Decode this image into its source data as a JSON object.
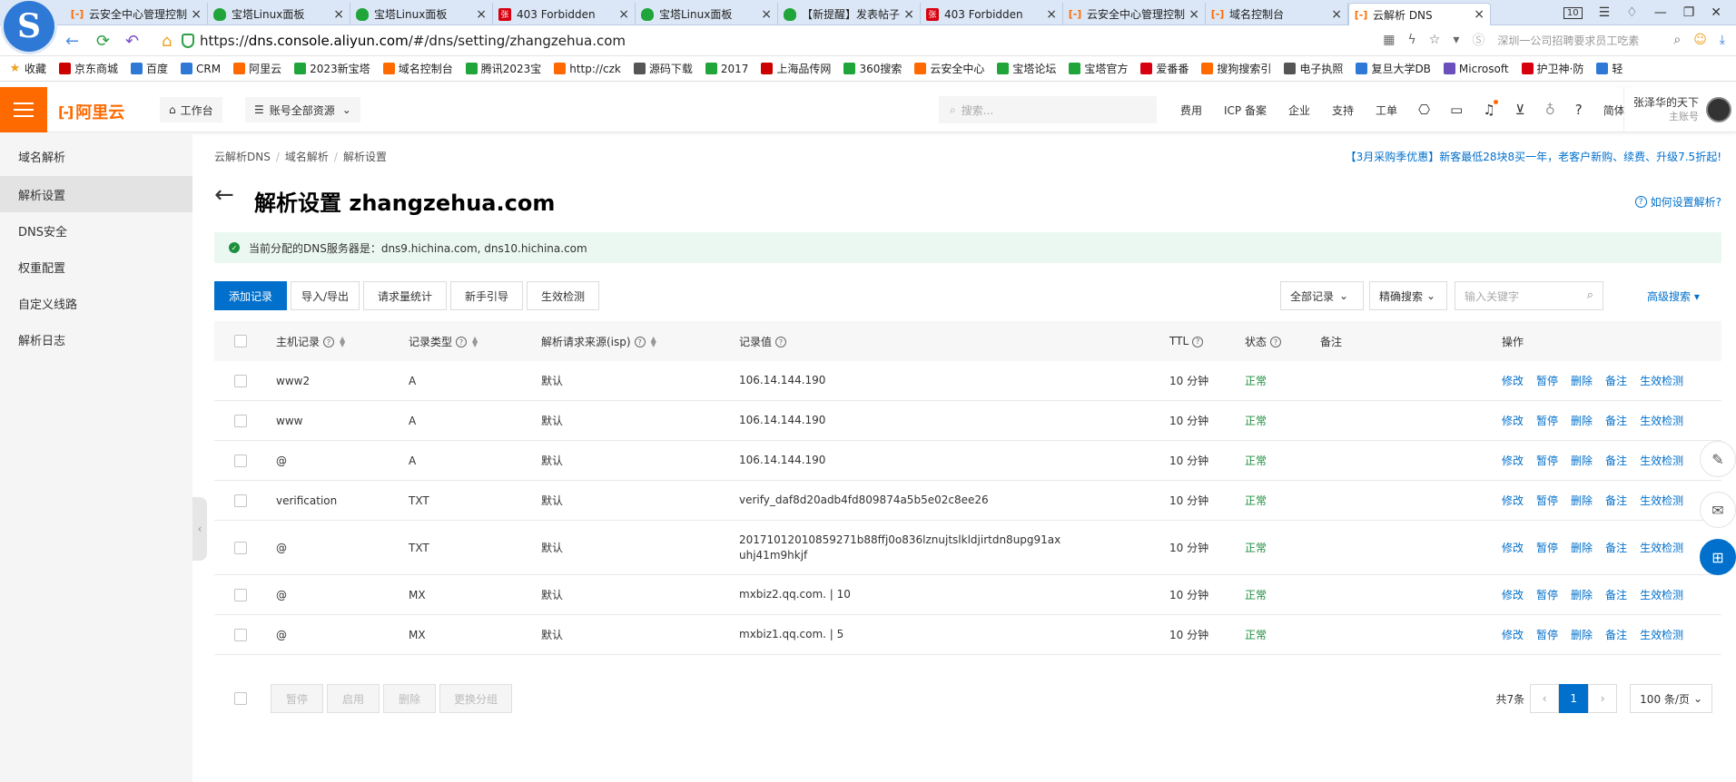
{
  "browser": {
    "tabs": [
      {
        "title": "云安全中心管理控制台",
        "icon": "ali"
      },
      {
        "title": "宝塔Linux面板",
        "icon": "bt"
      },
      {
        "title": "宝塔Linux面板",
        "icon": "bt"
      },
      {
        "title": "403 Forbidden",
        "icon": "err"
      },
      {
        "title": "宝塔Linux面板",
        "icon": "bt"
      },
      {
        "title": "【新提醒】发表帖子",
        "icon": "bt"
      },
      {
        "title": "403 Forbidden",
        "icon": "err"
      },
      {
        "title": "云安全中心管理控制台",
        "icon": "ali"
      },
      {
        "title": "域名控制台",
        "icon": "ali"
      },
      {
        "title": "云解析 DNS",
        "icon": "ali",
        "active": true
      }
    ],
    "tab_count": "10",
    "url_prefix": "https://",
    "url_domain": "dns.console.aliyun.com",
    "url_path": "/#/dns/setting/zhangzehua.com",
    "search_hint": "深圳一公司招聘要求员工吃素",
    "bookmarks": [
      "收藏",
      "京东商城",
      "百度",
      "CRM",
      "阿里云",
      "2023新宝塔",
      "域名控制台",
      "腾讯2023宝",
      "http://czk",
      "源码下载",
      "2017",
      "上海品传网",
      "360搜索",
      "云安全中心",
      "宝塔论坛",
      "宝塔官方",
      "爱番番",
      "搜狗搜索引",
      "电子执照",
      "复旦大学DB",
      "Microsoft",
      "护卫神·防",
      "轻"
    ]
  },
  "console": {
    "brand": "阿里云",
    "workbench": "工作台",
    "resources": "账号全部资源",
    "search_placeholder": "搜索...",
    "nav": [
      "费用",
      "ICP 备案",
      "企业",
      "支持",
      "工单"
    ],
    "lang": "简体",
    "user_name": "张泽华的天下",
    "user_role": "主账号"
  },
  "sidebar": {
    "items": [
      "域名解析",
      "解析设置",
      "DNS安全",
      "权重配置",
      "自定义线路",
      "解析日志"
    ]
  },
  "main": {
    "breadcrumb": [
      "云解析DNS",
      "域名解析",
      "解析设置"
    ],
    "promo": "【3月采购季优惠】新客最低28块8买一年，老客户新购、续费、升级7.5折起!",
    "title": "解析设置 zhangzehua.com",
    "help": "如何设置解析?",
    "notice": "当前分配的DNS服务器是：dns9.hichina.com, dns10.hichina.com",
    "buttons": [
      "添加记录",
      "导入/导出",
      "请求量统计",
      "新手引导",
      "生效检测"
    ],
    "filter_all": "全部记录",
    "filter_exact": "精确搜索",
    "keyword_placeholder": "输入关键字",
    "advanced": "高级搜索",
    "columns": {
      "host": "主机记录",
      "type": "记录类型",
      "isp": "解析请求来源(isp)",
      "value": "记录值",
      "ttl": "TTL",
      "status": "状态",
      "remark": "备注",
      "ops": "操作"
    },
    "rows": [
      {
        "host": "www2",
        "type": "A",
        "isp": "默认",
        "value": "106.14.144.190",
        "value2": "",
        "ttl": "10 分钟",
        "status": "正常"
      },
      {
        "host": "www",
        "type": "A",
        "isp": "默认",
        "value": "106.14.144.190",
        "value2": "",
        "ttl": "10 分钟",
        "status": "正常"
      },
      {
        "host": "@",
        "type": "A",
        "isp": "默认",
        "value": "106.14.144.190",
        "value2": "",
        "ttl": "10 分钟",
        "status": "正常"
      },
      {
        "host": "verification",
        "type": "TXT",
        "isp": "默认",
        "value": "verify_daf8d20adb4fd809874a5b5e02c8ee26",
        "value2": "",
        "ttl": "10 分钟",
        "status": "正常"
      },
      {
        "host": "@",
        "type": "TXT",
        "isp": "默认",
        "value": "20171012010859271b88ffj0o836lznujtslkldjirtdn8upg91ax",
        "value2": "uhj41m9hkjf",
        "ttl": "10 分钟",
        "status": "正常"
      },
      {
        "host": "@",
        "type": "MX",
        "isp": "默认",
        "value": "mxbiz2.qq.com. | 10",
        "value2": "",
        "ttl": "10 分钟",
        "status": "正常"
      },
      {
        "host": "@",
        "type": "MX",
        "isp": "默认",
        "value": "mxbiz1.qq.com. | 5",
        "value2": "",
        "ttl": "10 分钟",
        "status": "正常"
      }
    ],
    "row_ops": [
      "修改",
      "暂停",
      "删除",
      "备注",
      "生效检测"
    ],
    "bulk": [
      "暂停",
      "启用",
      "删除",
      "更换分组"
    ],
    "total": "共7条",
    "page": "1",
    "per_page": "100 条/页"
  }
}
